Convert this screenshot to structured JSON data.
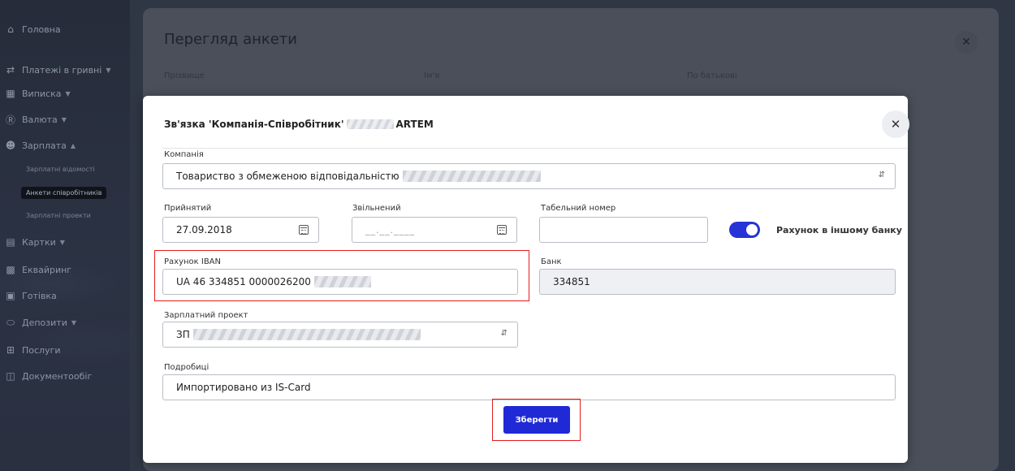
{
  "sidebar": {
    "items": [
      {
        "label": "Головна",
        "icon": "home-icon",
        "caret": false
      },
      {
        "label": "Платежі в гривні",
        "icon": "transfer-icon",
        "caret": true
      },
      {
        "label": "Виписка",
        "icon": "statement-icon",
        "caret": true
      },
      {
        "label": "Валюта",
        "icon": "currency-icon",
        "caret": true
      },
      {
        "label": "Зарплата",
        "icon": "people-icon",
        "caret": true,
        "caret_up": true
      },
      {
        "label": "Картки",
        "icon": "card-icon",
        "caret": true
      },
      {
        "label": "Еквайринг",
        "icon": "pos-icon",
        "caret": false
      },
      {
        "label": "Готівка",
        "icon": "cash-icon",
        "caret": false
      },
      {
        "label": "Депозити",
        "icon": "deposit-icon",
        "caret": true
      },
      {
        "label": "Послуги",
        "icon": "services-icon",
        "caret": false
      },
      {
        "label": "Документообіг",
        "icon": "docs-icon",
        "caret": false
      }
    ],
    "salary_sub": [
      "Зарплатні відомості",
      "Анкети співробітників",
      "Зарплатні проекти"
    ],
    "active_sub": "Анкети співробітників"
  },
  "outer": {
    "title": "Перегляд анкети",
    "labels": [
      "Прізвище",
      "Ім'я",
      "По батькові"
    ]
  },
  "modal": {
    "title_prefix": "Зв'язка 'Компанія-Співробітник'",
    "title_suffix": "ARTEM",
    "company_label": "Компанія",
    "company_value": "Товариство з обмеженою відповідальністю",
    "hired_label": "Прийнятий",
    "hired_value": "27.09.2018",
    "fired_label": "Звільнений",
    "fired_placeholder": "__.__.____",
    "tab_label": "Табельний номер",
    "tab_value": "",
    "toggle_label": "Рахунок в іншому банку",
    "toggle_on": true,
    "iban_label": "Рахунок IBAN",
    "iban_value": "UA 46 334851 0000026200",
    "bank_label": "Банк",
    "bank_value": "334851",
    "project_label": "Зарплатний проект",
    "project_value": "ЗП",
    "details_label": "Подробиці",
    "details_value": "Импортировано из IS-Card",
    "save_label": "Зберегти"
  },
  "colors": {
    "primary": "#1f2ad6",
    "highlight": "#e31d1d"
  }
}
